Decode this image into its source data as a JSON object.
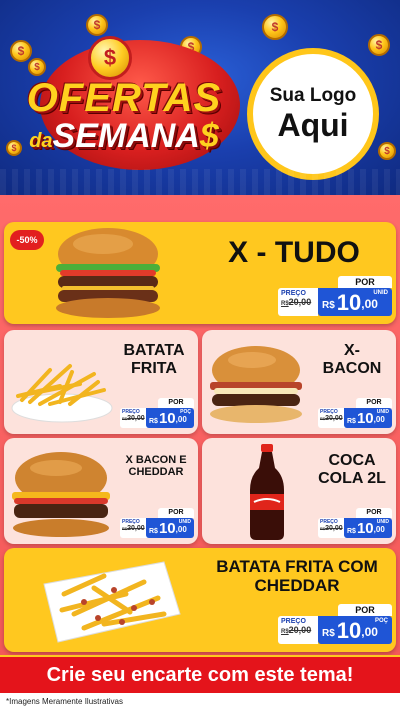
{
  "header": {
    "title_line1": "OFERTAS",
    "title_small": "da",
    "title_line2": "SEMANA",
    "title_dollar": "$",
    "coin_symbol": "$",
    "logo_line1": "Sua Logo",
    "logo_line2": "Aqui",
    "colors": {
      "blue": "#1a3fae",
      "red": "#d81f1f",
      "gold": "#ffc61a"
    }
  },
  "products": [
    {
      "name": "X - TUDO",
      "discount": "-50%",
      "por": "POR",
      "preco_label": "PREÇO",
      "old_currency": "R$",
      "old_price": "20,00",
      "currency": "R$",
      "price_int": "10",
      "price_dec": ",00",
      "unit": "UNID",
      "icon": "burger-icon"
    },
    {
      "name_line1": "BATATA",
      "name_line2": "FRITA",
      "por": "POR",
      "preco_label": "PREÇO",
      "old_currency": "R$",
      "old_price": "20,00",
      "currency": "R$",
      "price_int": "10",
      "price_dec": ",00",
      "unit": "POÇ",
      "icon": "fries-icon"
    },
    {
      "name_line1": "X-",
      "name_line2": "BACON",
      "por": "POR",
      "preco_label": "PREÇO",
      "old_currency": "R$",
      "old_price": "20,00",
      "currency": "R$",
      "price_int": "10",
      "price_dec": ",00",
      "unit": "UNID",
      "icon": "burger-icon"
    },
    {
      "name_line1": "X BACON E",
      "name_line2": "CHEDDAR",
      "por": "POR",
      "preco_label": "PREÇO",
      "old_currency": "R$",
      "old_price": "20,00",
      "currency": "R$",
      "price_int": "10",
      "price_dec": ",00",
      "unit": "UNID",
      "icon": "burger-icon"
    },
    {
      "name_line1": "COCA",
      "name_line2": "COLA 2L",
      "por": "POR",
      "preco_label": "PREÇO",
      "old_currency": "R$",
      "old_price": "20,00",
      "currency": "R$",
      "price_int": "10",
      "price_dec": ",00",
      "unit": "UNID",
      "icon": "soda-bottle-icon"
    },
    {
      "name_line1": "BATATA FRITA COM",
      "name_line2": "CHEDDAR",
      "por": "POR",
      "preco_label": "PREÇO",
      "old_currency": "R$",
      "old_price": "20,00",
      "currency": "R$",
      "price_int": "10",
      "price_dec": ",00",
      "unit": "POÇ",
      "icon": "cheese-fries-icon"
    }
  ],
  "cta": "Crie seu encarte com este tema!",
  "footer": "*Imagens Meramente Ilustrativas"
}
